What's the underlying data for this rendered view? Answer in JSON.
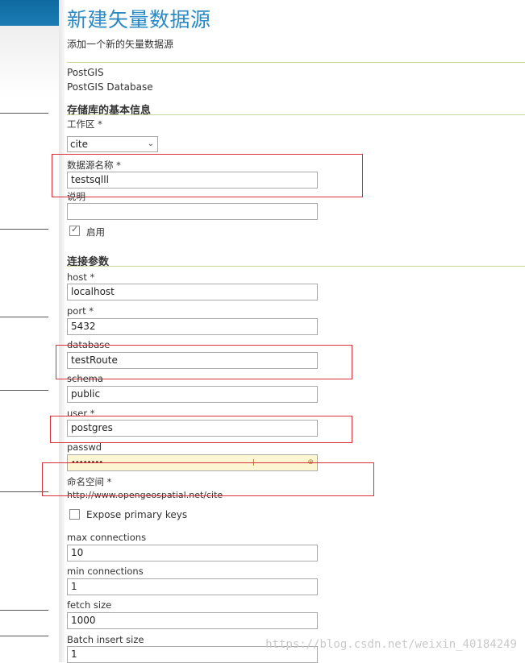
{
  "page": {
    "title": "新建矢量数据源",
    "subtitle": "添加一个新的矢量数据源"
  },
  "store_type": {
    "name": "PostGIS",
    "description": "PostGIS Database"
  },
  "basic_info": {
    "heading": "存储库的基本信息",
    "workspace_label": "工作区 *",
    "workspace_value": "cite",
    "datasource_name_label": "数据源名称 *",
    "datasource_name_value": "testsqlll",
    "description_label": "说明",
    "description_value": "",
    "enabled_label": "启用",
    "enabled": true
  },
  "connection": {
    "heading": "连接参数",
    "host_label": "host *",
    "host_value": "localhost",
    "port_label": "port *",
    "port_value": "5432",
    "database_label": "database",
    "database_value": "testRoute",
    "schema_label": "schema",
    "schema_value": "public",
    "user_label": "user *",
    "user_value": "postgres",
    "passwd_label": "passwd",
    "passwd_value": "••••••••",
    "namespace_label": "命名空间 *",
    "namespace_value": "http://www.opengeospatial.net/cite",
    "expose_pk_label": "Expose primary keys",
    "expose_pk": false,
    "max_connections_label": "max connections",
    "max_connections_value": "10",
    "min_connections_label": "min connections",
    "min_connections_value": "1",
    "fetch_size_label": "fetch size",
    "fetch_size_value": "1000",
    "batch_insert_label": "Batch insert size",
    "batch_insert_value": "1"
  },
  "watermark": "https://blog.csdn.net/weixin_40184249",
  "colors": {
    "title": "#2b8ac3",
    "highlight_box": "#d9303a",
    "password_bg": "#fcf6d2"
  }
}
